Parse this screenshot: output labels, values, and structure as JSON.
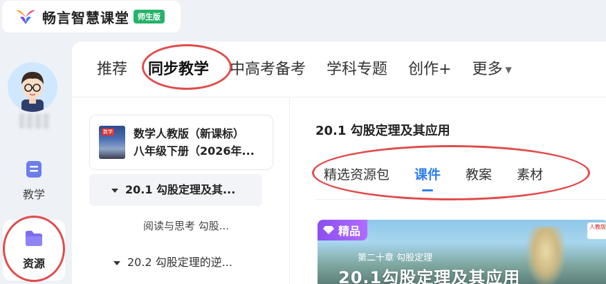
{
  "app": {
    "logo_text": "畅言智慧课堂",
    "badge": "师生版"
  },
  "sidebar": {
    "items": [
      {
        "label": "教学",
        "icon": "teaching-icon",
        "active": false
      },
      {
        "label": "资源",
        "icon": "resource-folder-icon",
        "active": true
      }
    ]
  },
  "top_tabs": [
    {
      "label": "推荐",
      "active": false
    },
    {
      "label": "同步教学",
      "active": true
    },
    {
      "label": "中高考备考",
      "active": false
    },
    {
      "label": "学科专题",
      "active": false
    },
    {
      "label": "创作+",
      "active": false
    },
    {
      "label": "更多",
      "active": false,
      "has_caret": true
    }
  ],
  "book": {
    "cover_label": "数学",
    "title_line1": "数学人教版（新课标）",
    "title_line2": "八年级下册（2026年..."
  },
  "tree": {
    "active_item": "20.1 勾股定理及其...",
    "sub_item": "阅读与思考 勾股...",
    "next_item": "20.2 勾股定理的逆..."
  },
  "content": {
    "section_title": "20.1 勾股定理及其应用",
    "sub_tabs": [
      {
        "label": "精选资源包",
        "active": false
      },
      {
        "label": "课件",
        "active": true
      },
      {
        "label": "教案",
        "active": false
      },
      {
        "label": "素材",
        "active": false
      }
    ],
    "card": {
      "badge": "精品",
      "chapter": "第二十章  勾股定理",
      "title": "20.1勾股定理及其应用",
      "publisher_tag": "人教版"
    }
  },
  "colors": {
    "accent": "#2f7ef0",
    "annotation": "#e14b4b",
    "badge_green": "#27b36b",
    "premium_purple": "#9b5cf6"
  }
}
